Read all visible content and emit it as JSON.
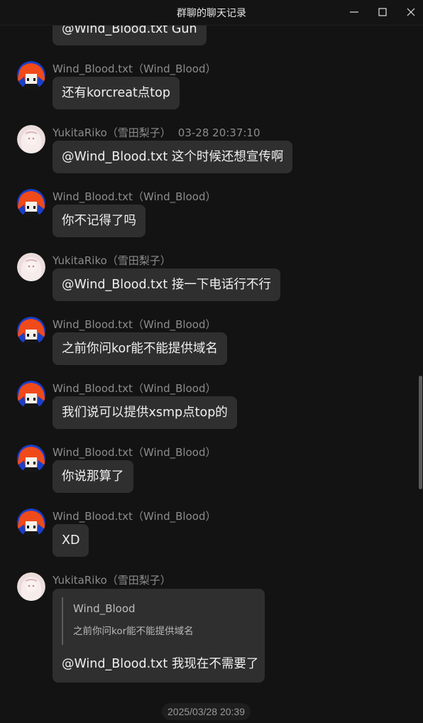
{
  "window": {
    "title": "群聊的聊天记录",
    "controls": [
      "minimize-icon",
      "maximize-icon",
      "close-icon"
    ]
  },
  "messages": [
    {
      "sender": "",
      "time": "",
      "text": "@Wind_Blood.txt Gun",
      "avatar": "wind-blood"
    },
    {
      "sender": "Wind_Blood.txt（Wind_Blood）",
      "time": "",
      "text": "还有korcreat点top",
      "avatar": "wind-blood"
    },
    {
      "sender": "YukitaRiko（雪田梨子）",
      "time": "03-28 20:37:10",
      "text": "@Wind_Blood.txt 这个时候还想宣传啊",
      "avatar": "yukita-riko"
    },
    {
      "sender": "Wind_Blood.txt（Wind_Blood）",
      "time": "",
      "text": "你不记得了吗",
      "avatar": "wind-blood"
    },
    {
      "sender": "YukitaRiko（雪田梨子）",
      "time": "",
      "text": "@Wind_Blood.txt 接一下电话行不行",
      "avatar": "yukita-riko"
    },
    {
      "sender": "Wind_Blood.txt（Wind_Blood）",
      "time": "",
      "text": "之前你问kor能不能提供域名",
      "avatar": "wind-blood"
    },
    {
      "sender": "Wind_Blood.txt（Wind_Blood）",
      "time": "",
      "text": "我们说可以提供xsmp点top的",
      "avatar": "wind-blood"
    },
    {
      "sender": "Wind_Blood.txt（Wind_Blood）",
      "time": "",
      "text": "你说那算了",
      "avatar": "wind-blood"
    },
    {
      "sender": "Wind_Blood.txt（Wind_Blood）",
      "time": "",
      "text": "XD",
      "avatar": "wind-blood"
    },
    {
      "sender": "YukitaRiko（雪田梨子）",
      "time": "",
      "text": "@Wind_Blood.txt 我现在不需要了",
      "avatar": "yukita-riko",
      "quote": {
        "author": "Wind_Blood",
        "text": "之前你问kor能不能提供域名"
      }
    }
  ],
  "date_divider": "2025/03/28 20:39",
  "colors": {
    "background": "#131313",
    "bubble": "#2f2f2f",
    "meta_text": "#8c8c8c",
    "message_text": "#f0f0f0"
  }
}
